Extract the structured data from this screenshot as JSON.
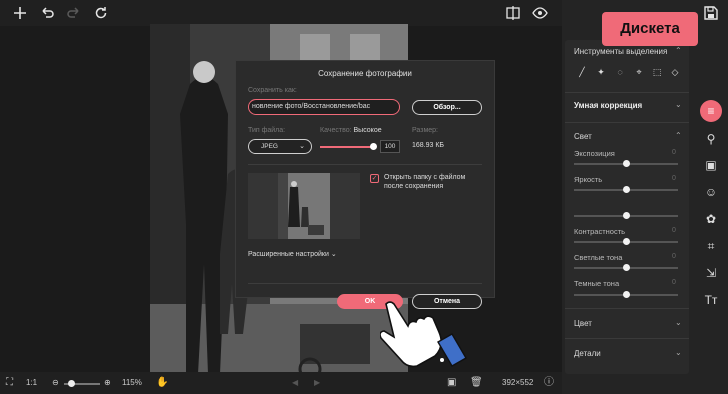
{
  "badge": {
    "text": "Дискета"
  },
  "dialog": {
    "title": "Сохранение фотографии",
    "save_as_label": "Сохранить как:",
    "path_value": "новление фото/Восстановление/bac",
    "browse_label": "Обзор...",
    "file_type_label": "Тип файла:",
    "file_type_value": "JPEG",
    "quality_label": "Качество:",
    "quality_level": "Высокое",
    "quality_value": "100",
    "size_label": "Размер:",
    "size_value": "168.93 КБ",
    "open_folder_label": "Открыть папку с файлом после сохранения",
    "advanced_label": "Расширенные настройки",
    "ok_label": "OK",
    "cancel_label": "Отмена"
  },
  "panel": {
    "selection_tools_title": "Инструменты выделения",
    "smart_correction_title": "Умная коррекция",
    "light_title": "Свет",
    "color_title": "Цвет",
    "details_title": "Детали",
    "sliders": [
      {
        "label": "Экспозиция",
        "value": "0"
      },
      {
        "label": "Яркость",
        "value": "0"
      },
      {
        "label": "Контрастность",
        "value": "0"
      },
      {
        "label": "Светлые тона",
        "value": "0"
      },
      {
        "label": "Темные тона",
        "value": "0"
      }
    ]
  },
  "bottombar": {
    "ratio": "1:1",
    "zoom": "115%",
    "dimensions": "392×552"
  },
  "colors": {
    "accent": "#f06a78",
    "bg": "#1b1b1b",
    "panel": "#2a2a2a"
  }
}
